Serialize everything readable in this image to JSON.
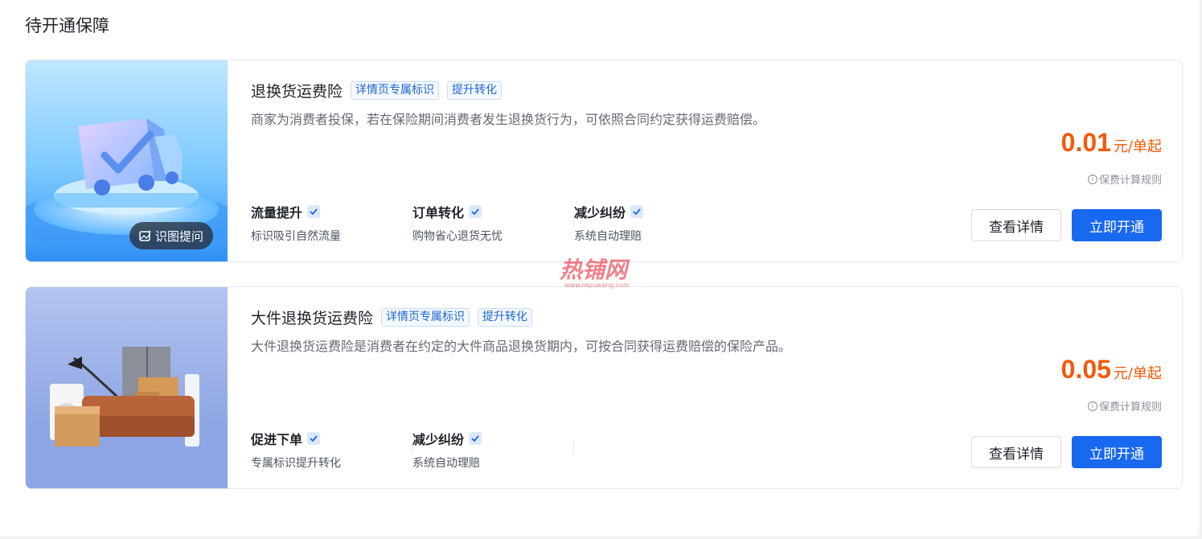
{
  "section_title": "待开通保障",
  "cards": [
    {
      "name": "退换货运费险",
      "tags": [
        "详情页专属标识",
        "提升转化"
      ],
      "description": "商家为消费者投保，若在保险期间消费者发生退换货行为，可依照合同约定获得运费赔偿。",
      "ai_chip_label": "识图提问",
      "features": [
        {
          "title": "流量提升",
          "subtitle": "标识吸引自然流量"
        },
        {
          "title": "订单转化",
          "subtitle": "购物省心退货无忧"
        },
        {
          "title": "减少纠纷",
          "subtitle": "系统自动理赔"
        }
      ],
      "price": "0.01",
      "price_unit": "元/单起",
      "rule_label": "保费计算规则",
      "detail_button": "查看详情",
      "open_button": "立即开通"
    },
    {
      "name": "大件退换货运费险",
      "tags": [
        "详情页专属标识",
        "提升转化"
      ],
      "description": "大件退换货运费险是消费者在约定的大件商品退换货期内，可按合同获得运费赔偿的保险产品。",
      "features": [
        {
          "title": "促进下单",
          "subtitle": "专属标识提升转化"
        },
        {
          "title": "减少纠纷",
          "subtitle": "系统自动理赔"
        }
      ],
      "price": "0.05",
      "price_unit": "元/单起",
      "rule_label": "保费计算规则",
      "detail_button": "查看详情",
      "open_button": "立即开通"
    }
  ],
  "watermark": {
    "text": "热铺网",
    "url": "www.repuwang.com"
  },
  "colors": {
    "accent": "#1868f0",
    "price": "#f25a0a",
    "tag": "#1f66d6"
  }
}
